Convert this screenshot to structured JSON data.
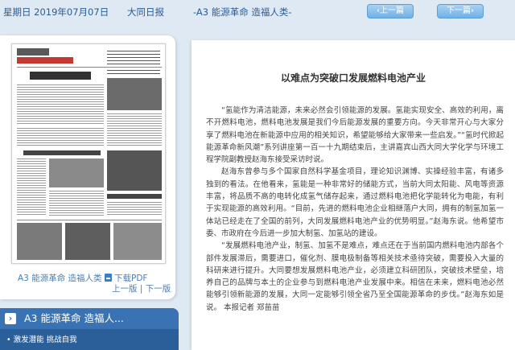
{
  "topbar": {
    "date": "星期日 2019年07月07日",
    "paper": "大同日报",
    "section": "-A3 能源革命 造福人类-",
    "prev_label": "上一篇",
    "next_label": "下一篇"
  },
  "leftpanel": {
    "page_label": "A3 能源革命 造福人类",
    "pdf_label": "下载PDF",
    "page_nav": "上一版 | 下一版"
  },
  "sections": {
    "current": "A3 能源革命 造福人...",
    "items": [
      "激发潜能 挑战自我"
    ]
  },
  "article": {
    "title": "以难点为突破口发展燃料电池产业",
    "paragraphs": [
      "“氢能作为清洁能源，未来必然会引领能源的发展。氢能实现安全、高效的利用，离不开燃料电池，燃料电池发展是我们今后能源发展的重要方向。今天非常开心与大家分享了燃料电池在新能源中应用的相关知识，希望能够给大家带来一些启发。”“氢时代掀起能源革命新风潮”系列讲座第一百一十九期结束后，主讲嘉宾山西大同大学化学与环境工程学院副教授赵海东接受采访时说。",
      "赵海东曾参与多个国家自然科学基金项目，理论知识渊博、实操经验丰富，有诸多独到的看法。在他看来，氢能是一种非常好的储能方式，当前大同太阳能、风电等资源丰富，将品质不高的电转化成氢气储存起来，通过燃料电池把化学能转化为电能，有利于实现能源的高效利用。“目前，先进的燃料电池企业相继落户大同，拥有的制氢加氢一体站已经走在了全国的前列，大同发展燃料电池产业的优势明显。”赵海东说。他希望市委、市政府在今后进一步加大制氢、加氢站的建设。",
      "“发展燃料电池产业，制氢、加氢不是难点，难点还在于当前国内燃料电池内部各个部件发展滞后，需要进口，催化剂、膜电极制备等相关技术亟待突破，需要投入大量的科研来进行提升。大同要想发展燃料电池产业，必须建立科研团队，突破技术壁垒，培养自己的品牌与本土的企业参与到燃料电池产业发展中来。相信在未来，燃料电池必然能够引领新能源的发展，大同一定能够引领全省乃至全国能源革命的步伐。”赵海东如是说。  本报记者 郑苗苗"
    ]
  }
}
